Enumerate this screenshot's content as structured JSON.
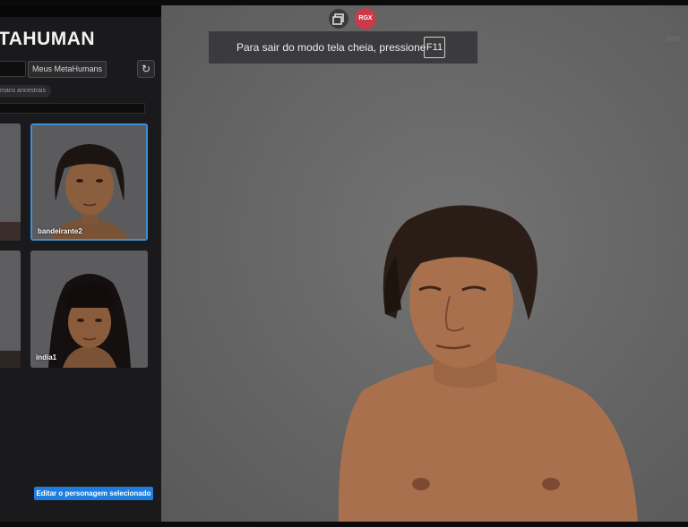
{
  "sidebar": {
    "logo": "TAHUMAN",
    "tab_my": "Meus MetaHumans",
    "crumb": "mans ancestrais",
    "cards": [
      {
        "label": "bandeirante2",
        "selected": true
      },
      {
        "label": "india1",
        "selected": false
      }
    ],
    "edit_button": "Editar o personagem selecionado"
  },
  "fullscreen_banner": {
    "text": "Para sair do modo tela cheia, pressione",
    "key": "F11"
  },
  "extension_badge": "RGX",
  "watermark": "iferti"
}
